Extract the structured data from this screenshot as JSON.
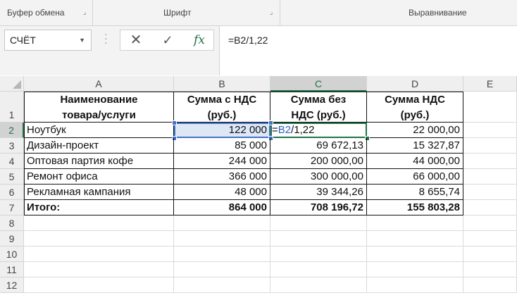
{
  "ribbon": {
    "clipboard": "Буфер обмена",
    "font": "Шрифт",
    "alignment": "Выравнивание"
  },
  "formula_bar": {
    "name_box": "СЧЁТ",
    "formula": "=B2/1,22",
    "cancel_icon": "close-icon",
    "enter_icon": "check-icon",
    "insert_function_label": "fx"
  },
  "sheet": {
    "columns": [
      "A",
      "B",
      "C",
      "D",
      "E"
    ],
    "rows": [
      "1",
      "2",
      "3",
      "4",
      "5",
      "6",
      "7",
      "8",
      "9",
      "10",
      "11",
      "12"
    ],
    "active_column": "C",
    "active_row": "2",
    "header": {
      "a_line1": "Наименование",
      "a_line2": "товара/услуги",
      "b_line1": "Сумма с НДС",
      "b_line2": "(руб.)",
      "c_line1": "Сумма без",
      "c_line2": "НДС (руб.)",
      "d_line1": "Сумма НДС",
      "d_line2": "(руб.)"
    },
    "data": [
      {
        "name": "Ноутбук",
        "with_vat": "122 000",
        "without_vat_eq": "=",
        "without_vat_ref": "B2",
        "without_vat_rest": "/1,22",
        "vat": "22 000,00"
      },
      {
        "name": "Дизайн-проект",
        "with_vat": "85 000",
        "without_vat": "69 672,13",
        "vat": "15 327,87"
      },
      {
        "name": "Оптовая партия кофе",
        "with_vat": "244 000",
        "without_vat": "200 000,00",
        "vat": "44 000,00"
      },
      {
        "name": "Ремонт офиса",
        "with_vat": "366 000",
        "without_vat": "300 000,00",
        "vat": "66 000,00"
      },
      {
        "name": "Рекламная кампания",
        "with_vat": "48 000",
        "without_vat": "39 344,26",
        "vat": "8 655,74"
      }
    ],
    "total": {
      "label": "Итого:",
      "with_vat": "864 000",
      "without_vat": "708 196,72",
      "vat": "155 803,28"
    }
  },
  "colors": {
    "accent_green": "#217346",
    "ref_blue": "#4472c4"
  }
}
